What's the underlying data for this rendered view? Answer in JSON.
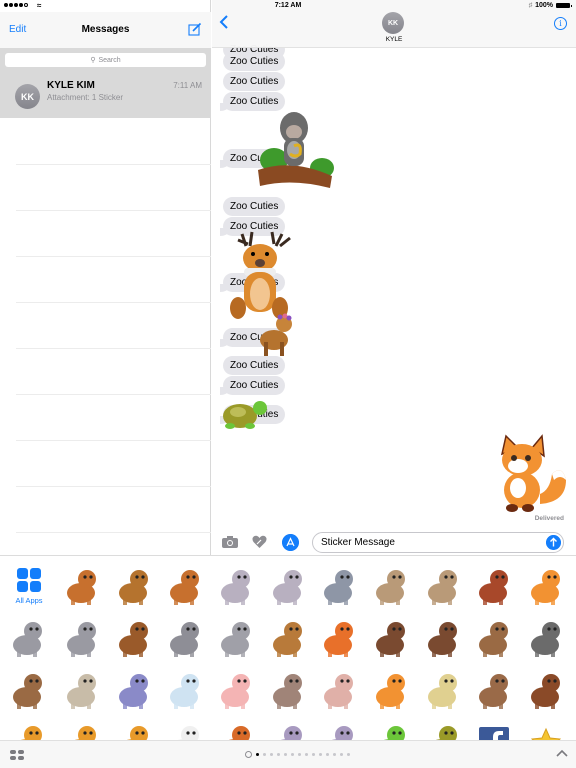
{
  "status_bar": {
    "time": "7:12 AM",
    "battery": "100%",
    "signal_bars_filled": 4,
    "signal_bars_total": 5
  },
  "sidebar": {
    "edit_label": "Edit",
    "title": "Messages",
    "search_placeholder": "Search",
    "conversations": [
      {
        "initials": "KK",
        "name": "KYLE KIM",
        "time": "7:11 AM",
        "preview": "Attachment: 1 Sticker"
      }
    ]
  },
  "chat": {
    "contact_initials": "KK",
    "contact_name": "KYLE",
    "messages": [
      {
        "text": "Zoo Cuties"
      },
      {
        "text": "Zoo Cuties"
      },
      {
        "text": "Zoo Cuties"
      },
      {
        "text": "Zoo Cuties"
      },
      {
        "text": "Zoo Cuties"
      },
      {
        "text": "Zoo Cuties"
      },
      {
        "text": "Zoo Cuties"
      },
      {
        "text": "Zoo Cuties"
      },
      {
        "text": "Zoo Cuties"
      },
      {
        "text": "Zoo Cuties"
      },
      {
        "text": "Zoo Cuties"
      },
      {
        "text": "Zoo Cuties"
      }
    ],
    "stickers_on_messages": [
      "gorilla-on-branch",
      "reindeer",
      "fawn-with-flowers",
      "turtle"
    ],
    "sent_sticker": "fox",
    "delivered_label": "Delivered",
    "input_value": "Sticker Message"
  },
  "drawer": {
    "all_apps_label": "All Apps",
    "stickers": [
      [
        "reindeer-king",
        "fawn-flowers",
        "reindeer-sitting",
        "bunny-gray",
        "bunny-carrot",
        "seal-ball",
        "walrus-hat",
        "walrus-gray",
        "red-panda",
        "fox-masked"
      ],
      [
        "wolf-pup-collar",
        "wolf-pup-waving",
        "beaver-hardhat",
        "raccoon-beanie",
        "lemur",
        "meerkat-hula",
        "squirrel-flowers",
        "hedgehog-fruit",
        "hedgehog",
        "monkey-turban",
        "gorilla-branch"
      ],
      [
        "monkey-fez",
        "goat-hat",
        "owl-dress",
        "ram",
        "piglet",
        "boar-hat",
        "pig-spotted",
        "fox-sitting",
        "camel",
        "pony-saddle",
        "bison-headdress"
      ],
      [
        "bear-hat",
        "bear-propeller",
        "polar-bear",
        "ermine-hat",
        "orangutan",
        "hippo",
        "hippo-snorkel",
        "frog",
        "turtle",
        "facebook",
        "star"
      ]
    ],
    "page_count": 14,
    "active_page": 1
  },
  "colors": {
    "accent": "#147efb",
    "bubble": "#e5e5ea",
    "selected_row": "#d9d9d9",
    "secondary_text": "#8e8e93"
  }
}
